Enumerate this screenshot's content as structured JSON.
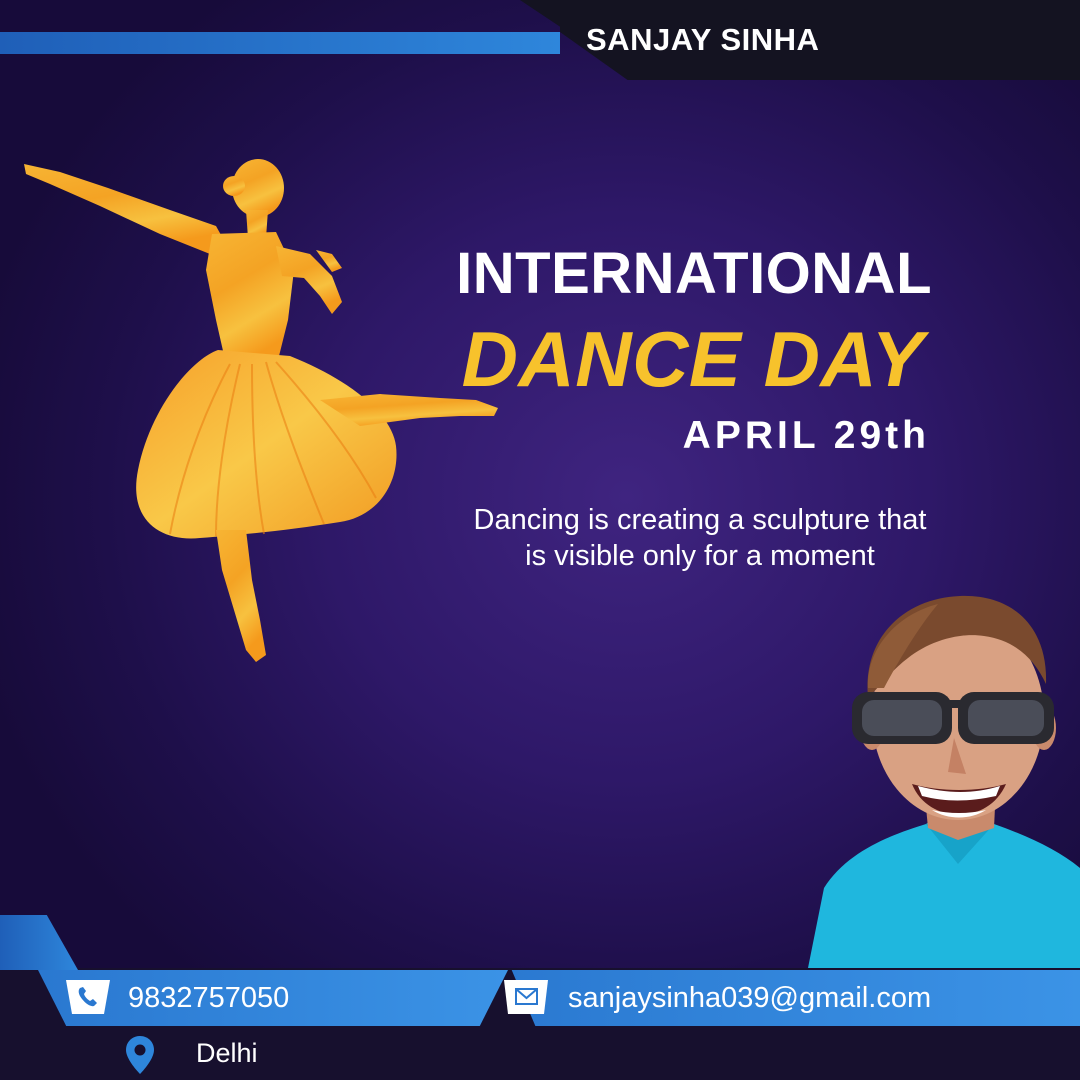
{
  "header": {
    "brand_name": "SANJAY SINHA"
  },
  "title": {
    "line1": "INTERNATIONAL",
    "line2": "DANCE DAY",
    "date": "APRIL 29th"
  },
  "quote": {
    "line1": "Dancing is creating a sculpture that",
    "line2": "is visible only for a moment"
  },
  "contact": {
    "phone": "9832757050",
    "email": "sanjaysinha039@gmail.com",
    "location": "Delhi"
  },
  "icons": {
    "phone": "phone-icon",
    "email": "envelope-icon",
    "location": "map-pin-icon"
  },
  "colors": {
    "background": "#2e1868",
    "accent_blue": "#2e86db",
    "title_yellow": "#f7c22c",
    "dancer_orange": "#f39a1d"
  }
}
